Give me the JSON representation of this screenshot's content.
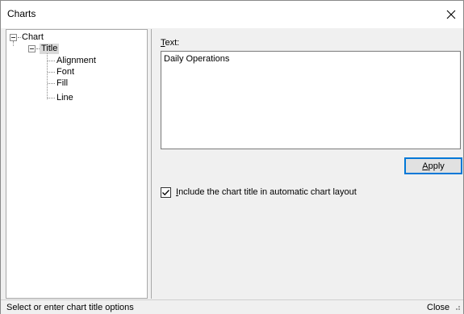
{
  "window": {
    "title": "Charts"
  },
  "tree": {
    "root": "Chart",
    "child": "Title",
    "leaves": [
      "Alignment",
      "Font",
      "Fill",
      "Line"
    ]
  },
  "editor": {
    "text_label_accel": "T",
    "text_label_rest": "ext:",
    "text_value": "Daily Operations",
    "apply_accel": "A",
    "apply_rest": "pply",
    "include_accel": "I",
    "include_rest": "nclude the chart title in automatic chart layout",
    "include_checked": true
  },
  "status": {
    "message": "Select or enter chart title options",
    "close_label": "Close"
  }
}
